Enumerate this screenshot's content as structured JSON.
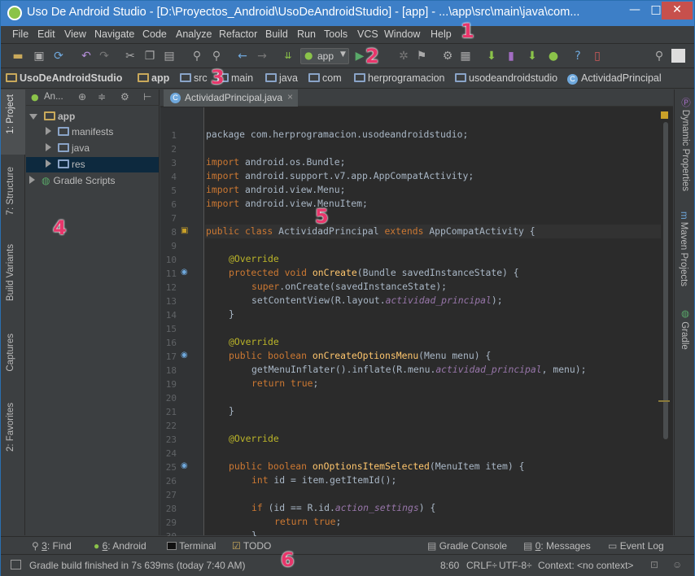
{
  "window": {
    "title": "Uso De Android Studio - [D:\\Proyectos_Android\\UsoDeAndroidStudio] - [app] - ...\\app\\src\\main\\java\\com...",
    "minimize": "—",
    "maximize": "□",
    "close": "✕"
  },
  "menu": [
    "File",
    "Edit",
    "View",
    "Navigate",
    "Code",
    "Analyze",
    "Refactor",
    "Build",
    "Run",
    "Tools",
    "VCS",
    "Window",
    "Help"
  ],
  "toolbar": {
    "run_config": "app"
  },
  "breadcrumb": [
    "UsoDeAndroidStudio",
    "app",
    "src",
    "main",
    "java",
    "com",
    "herprogramacion",
    "usodeandroidstudio",
    "ActividadPrincipal"
  ],
  "left_tabs": [
    "1: Project",
    "7: Structure",
    "Build Variants",
    "Captures",
    "2: Favorites"
  ],
  "project": {
    "view_label": "An...",
    "tree": [
      {
        "label": "app"
      },
      {
        "label": "manifests"
      },
      {
        "label": "java"
      },
      {
        "label": "res"
      },
      {
        "label": "Gradle Scripts"
      }
    ]
  },
  "editor": {
    "tab": "ActividadPrincipal.java",
    "tab_close": "×",
    "line_numbers": [
      "1",
      "2",
      "3",
      "4",
      "5",
      "6",
      "7",
      "8",
      "9",
      "10",
      "11",
      "12",
      "13",
      "14",
      "15",
      "16",
      "17",
      "18",
      "19",
      "20",
      "21",
      "22",
      "23",
      "24",
      "25",
      "26",
      "27",
      "28",
      "29",
      "30",
      "31"
    ],
    "code": {
      "l1": "package com.herprogramacion.usodeandroidstudio;",
      "l3a": "import",
      "l3b": " android.os.Bundle;",
      "l4a": "import",
      "l4b": " android.support.v7.app.AppCompatActivity;",
      "l5a": "import",
      "l5b": " android.view.Menu;",
      "l6a": "import",
      "l6b": " android.view.MenuItem;",
      "l8a": "public class",
      "l8b": " ActividadPrincipal ",
      "l8c": "extends",
      "l8d": " AppCompatActivity {",
      "l10": "@Override",
      "l11a": "protected void",
      "l11b": " onCreate",
      "l11c": "(Bundle savedInstanceState) {",
      "l12a": "super",
      "l12b": ".onCreate(savedInstanceState);",
      "l13a": "setContentView(R.layout.",
      "l13b": "actividad_principal",
      "l13c": ");",
      "l14": "}",
      "l16": "@Override",
      "l17a": "public boolean",
      "l17b": " onCreateOptionsMenu",
      "l17c": "(Menu menu) {",
      "l18a": "getMenuInflater().inflate(R.menu.",
      "l18b": "actividad_principal",
      "l18c": ", menu);",
      "l19a": "return true",
      "l19b": ";",
      "l21": "}",
      "l23": "@Override",
      "l25a": "public boolean",
      "l25b": " onOptionsItemSelected",
      "l25c": "(MenuItem item) {",
      "l26a": "int",
      "l26b": " id = item.getItemId();",
      "l28a": "if",
      "l28b": " (id == R.id.",
      "l28c": "action_settings",
      "l28d": ") {",
      "l29a": "return true",
      "l29b": ";",
      "l30": "}"
    }
  },
  "right_tabs": [
    "Dynamic Properties",
    "Maven Projects",
    "Gradle"
  ],
  "bottom_tools": [
    {
      "num": "3",
      "label": ": Find"
    },
    {
      "num": "6",
      "label": ": Android"
    },
    {
      "label": "Terminal"
    },
    {
      "label": "TODO"
    },
    {
      "label": "Gradle Console"
    },
    {
      "num": "0",
      "label": ": Messages"
    },
    {
      "label": "Event Log"
    }
  ],
  "status": {
    "message": "Gradle build finished in 7s 639ms (today 7:40 AM)",
    "position": "8:60",
    "line_sep": "CRLF÷",
    "encoding": "UTF-8÷",
    "context": "Context: <no context>"
  },
  "badges": [
    "1",
    "2",
    "3",
    "4",
    "5",
    "6"
  ],
  "colors": {
    "titlebar": "#3d7fc7",
    "bg": "#3c3f41",
    "editor_bg": "#2b2b2b",
    "keyword": "#cc7832",
    "annotation": "#bbb529",
    "field": "#9876aa",
    "method": "#ffc66d",
    "badge": "#e8366b"
  }
}
